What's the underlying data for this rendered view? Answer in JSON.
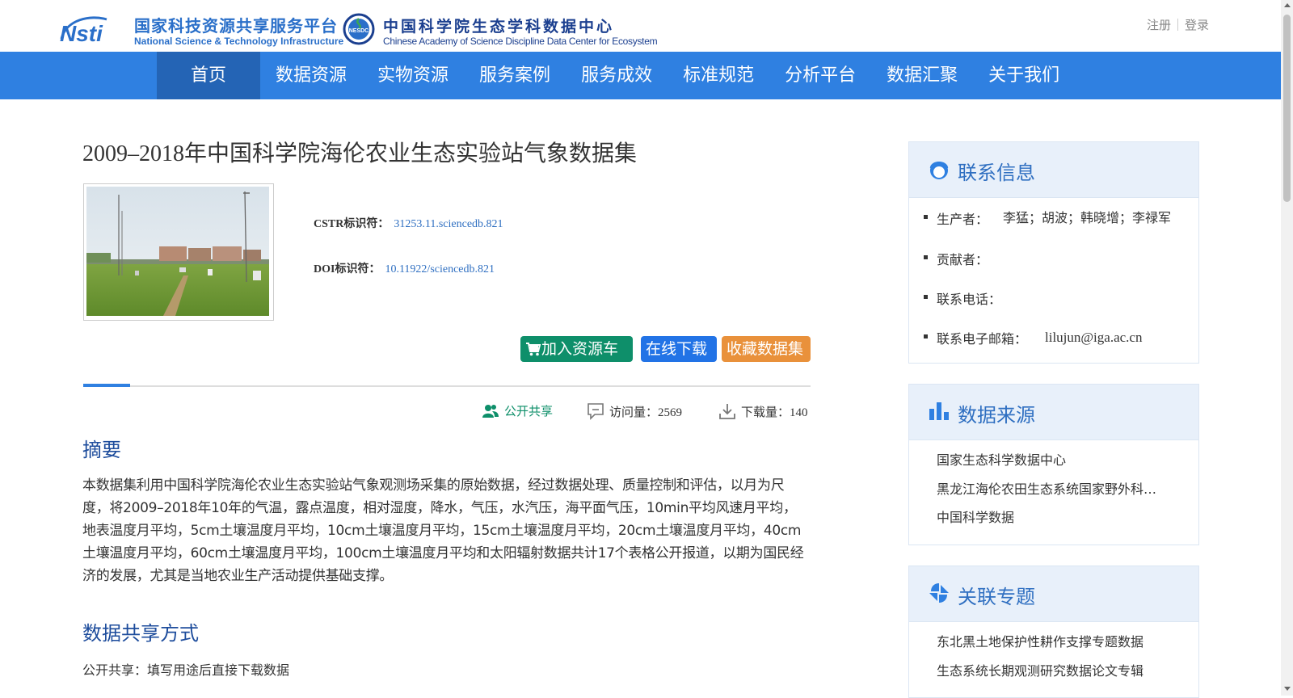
{
  "header": {
    "logo1": {
      "mark_text": "Nsti",
      "cn": "国家科技资源共享服务平台",
      "en": "National Science & Technology Infrastructure"
    },
    "logo2": {
      "badge_text": "NESDC",
      "cn": "中国科学院生态学科数据中心",
      "en": "Chinese Academy of Science Discipline Data Center for Ecosystem"
    },
    "register": "注册",
    "login": "登录"
  },
  "nav": {
    "items": [
      "首页",
      "数据资源",
      "实物资源",
      "服务案例",
      "服务成效",
      "标准规范",
      "分析平台",
      "数据汇聚",
      "关于我们"
    ],
    "active_index": 0
  },
  "dataset": {
    "title": "2009–2018年中国科学院海伦农业生态实验站气象数据集",
    "cstr_label": "CSTR标识符：",
    "cstr_value": "31253.11.sciencedb.821",
    "doi_label": "DOI标识符：",
    "doi_value": "10.11922/sciencedb.821",
    "add_cart": "加入资源车",
    "download": "在线下载",
    "favorite": "收藏数据集",
    "share_mode": "公开共享",
    "visits_label": "访问量：",
    "visits": "2569",
    "downloads_label": "下载量：",
    "downloads": "140"
  },
  "abstract": {
    "heading": "摘要",
    "text": "本数据集利用中国科学院海伦农业生态实验站气象观测场采集的原始数据，经过数据处理、质量控制和评估，以月为尺度，将2009–2018年10年的气温，露点温度，相对湿度，降水，气压，水汽压，海平面气压，10min平均风速月平均，地表温度月平均，5cm土壤温度月平均，10cm土壤温度月平均，15cm土壤温度月平均，20cm土壤温度月平均，40cm土壤温度月平均，60cm土壤温度月平均，100cm土壤温度月平均和太阳辐射数据共计17个表格公开报道，以期为国民经济的发展，尤其是当地农业生产活动提供基础支撑。"
  },
  "sharing": {
    "heading": "数据共享方式",
    "text": "公开共享：填写用途后直接下载数据"
  },
  "contact": {
    "title": "联系信息",
    "producer_label": "生产者：",
    "producer_value": "李猛；胡波；韩晓增；李禄军",
    "contributor_label": "贡献者：",
    "contributor_value": "",
    "phone_label": "联系电话：",
    "phone_value": "",
    "email_label": "联系电子邮箱：",
    "email_value": "lilujun@iga.ac.cn"
  },
  "source": {
    "title": "数据来源",
    "items": [
      "国家生态科学数据中心",
      "黑龙江海伦农田生态系统国家野外科…",
      "中国科学数据"
    ]
  },
  "topics": {
    "title": "关联专题",
    "items": [
      "东北黑土地保护性耕作支撑专题数据",
      "生态系统长期观测研究数据论文专辑"
    ]
  },
  "colors": {
    "nav_bg": "#2f80e1",
    "nav_active": "#2464b5",
    "cart_btn": "#0e8f6a",
    "download_btn": "#2273e6",
    "favorite_btn": "#e9913b",
    "heading_blue": "#1d4c9c",
    "share_green": "#0e8f6a"
  }
}
